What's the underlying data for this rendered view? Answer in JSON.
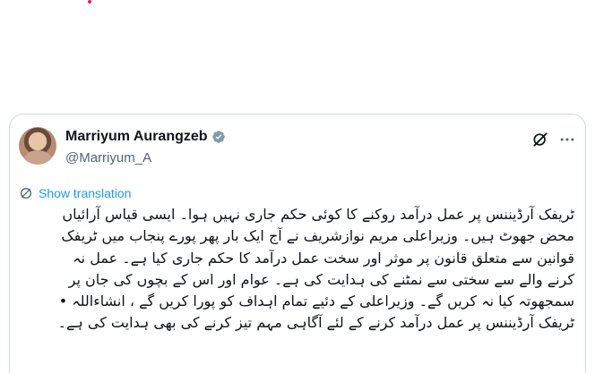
{
  "tweet": {
    "author": {
      "display_name": "Marriyum Aurangzeb",
      "handle": "@Marriyum_A",
      "verified": true
    },
    "translate_label": "Show translation",
    "lines": [
      "ٹریفک آرڈیننس پر عمل درآمد روکنے کا کوئی حکم جاری نہیں ہوا۔ ایسی قیاس آرائیاں",
      "محض جھوٹ ہیں۔ وزیراعلی مریم نوازشریف نے آج ایک بار پھر پورے پنجاب میں ٹریفک",
      "قوانین سے متعلق قانون پر موثر اور سخت عمل درآمد کا حکم جاری کیا ہے۔ عمل نہ",
      "کرنے والے سے سختی سے نمٹنے کی ہدایت کی ہے۔ عوام اور اس کے بچوں کی جان پر",
      "سمجھوتہ کیا نہ کریں گے۔ وزیراعلی کے دئیے تمام اہداف کو پورا کریں گے ، انشاءاللہ •",
      "ٹریفک آرڈیننس پر عمل درآمد کرنے کے لئے آگاہی مہم تیز کرنے کی بھی ہدایت کی ہے۔"
    ]
  },
  "colors": {
    "text": "#0f1419",
    "secondary": "#536471",
    "link": "#1d9bf0",
    "verified": "#829aab",
    "border": "#cfd9de"
  },
  "icons": [
    "verified-badge-icon",
    "grok-icon",
    "more-icon",
    "translate-icon"
  ]
}
